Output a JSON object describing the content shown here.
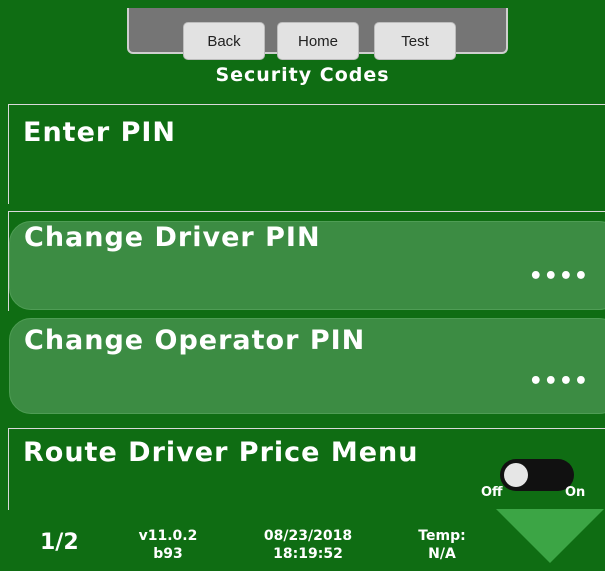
{
  "nav": {
    "back": "Back",
    "home": "Home",
    "test": "Test"
  },
  "page_title": "Security Codes",
  "items": [
    {
      "title": "Enter PIN"
    },
    {
      "title": "Change Driver PIN",
      "value": "••••"
    },
    {
      "title": "Change Operator PIN",
      "value": "••••"
    },
    {
      "title": "Route Driver Price Menu",
      "toggle": {
        "off_label": "Off",
        "on_label": "On",
        "state": "off"
      }
    }
  ],
  "footer": {
    "page": "1/2",
    "version": "v11.0.2",
    "build": "b93",
    "date": "08/23/2018",
    "time": "18:19:52",
    "temp_label": "Temp:",
    "temp_value": "N/A"
  },
  "icons": {
    "next_page": "triangle-down-icon",
    "toggle_knob": "circle-icon"
  },
  "colors": {
    "background": "#0f6d13",
    "card": "#3c8c43",
    "arrow": "#3ca545",
    "nav_button": "#e2e2e2"
  }
}
